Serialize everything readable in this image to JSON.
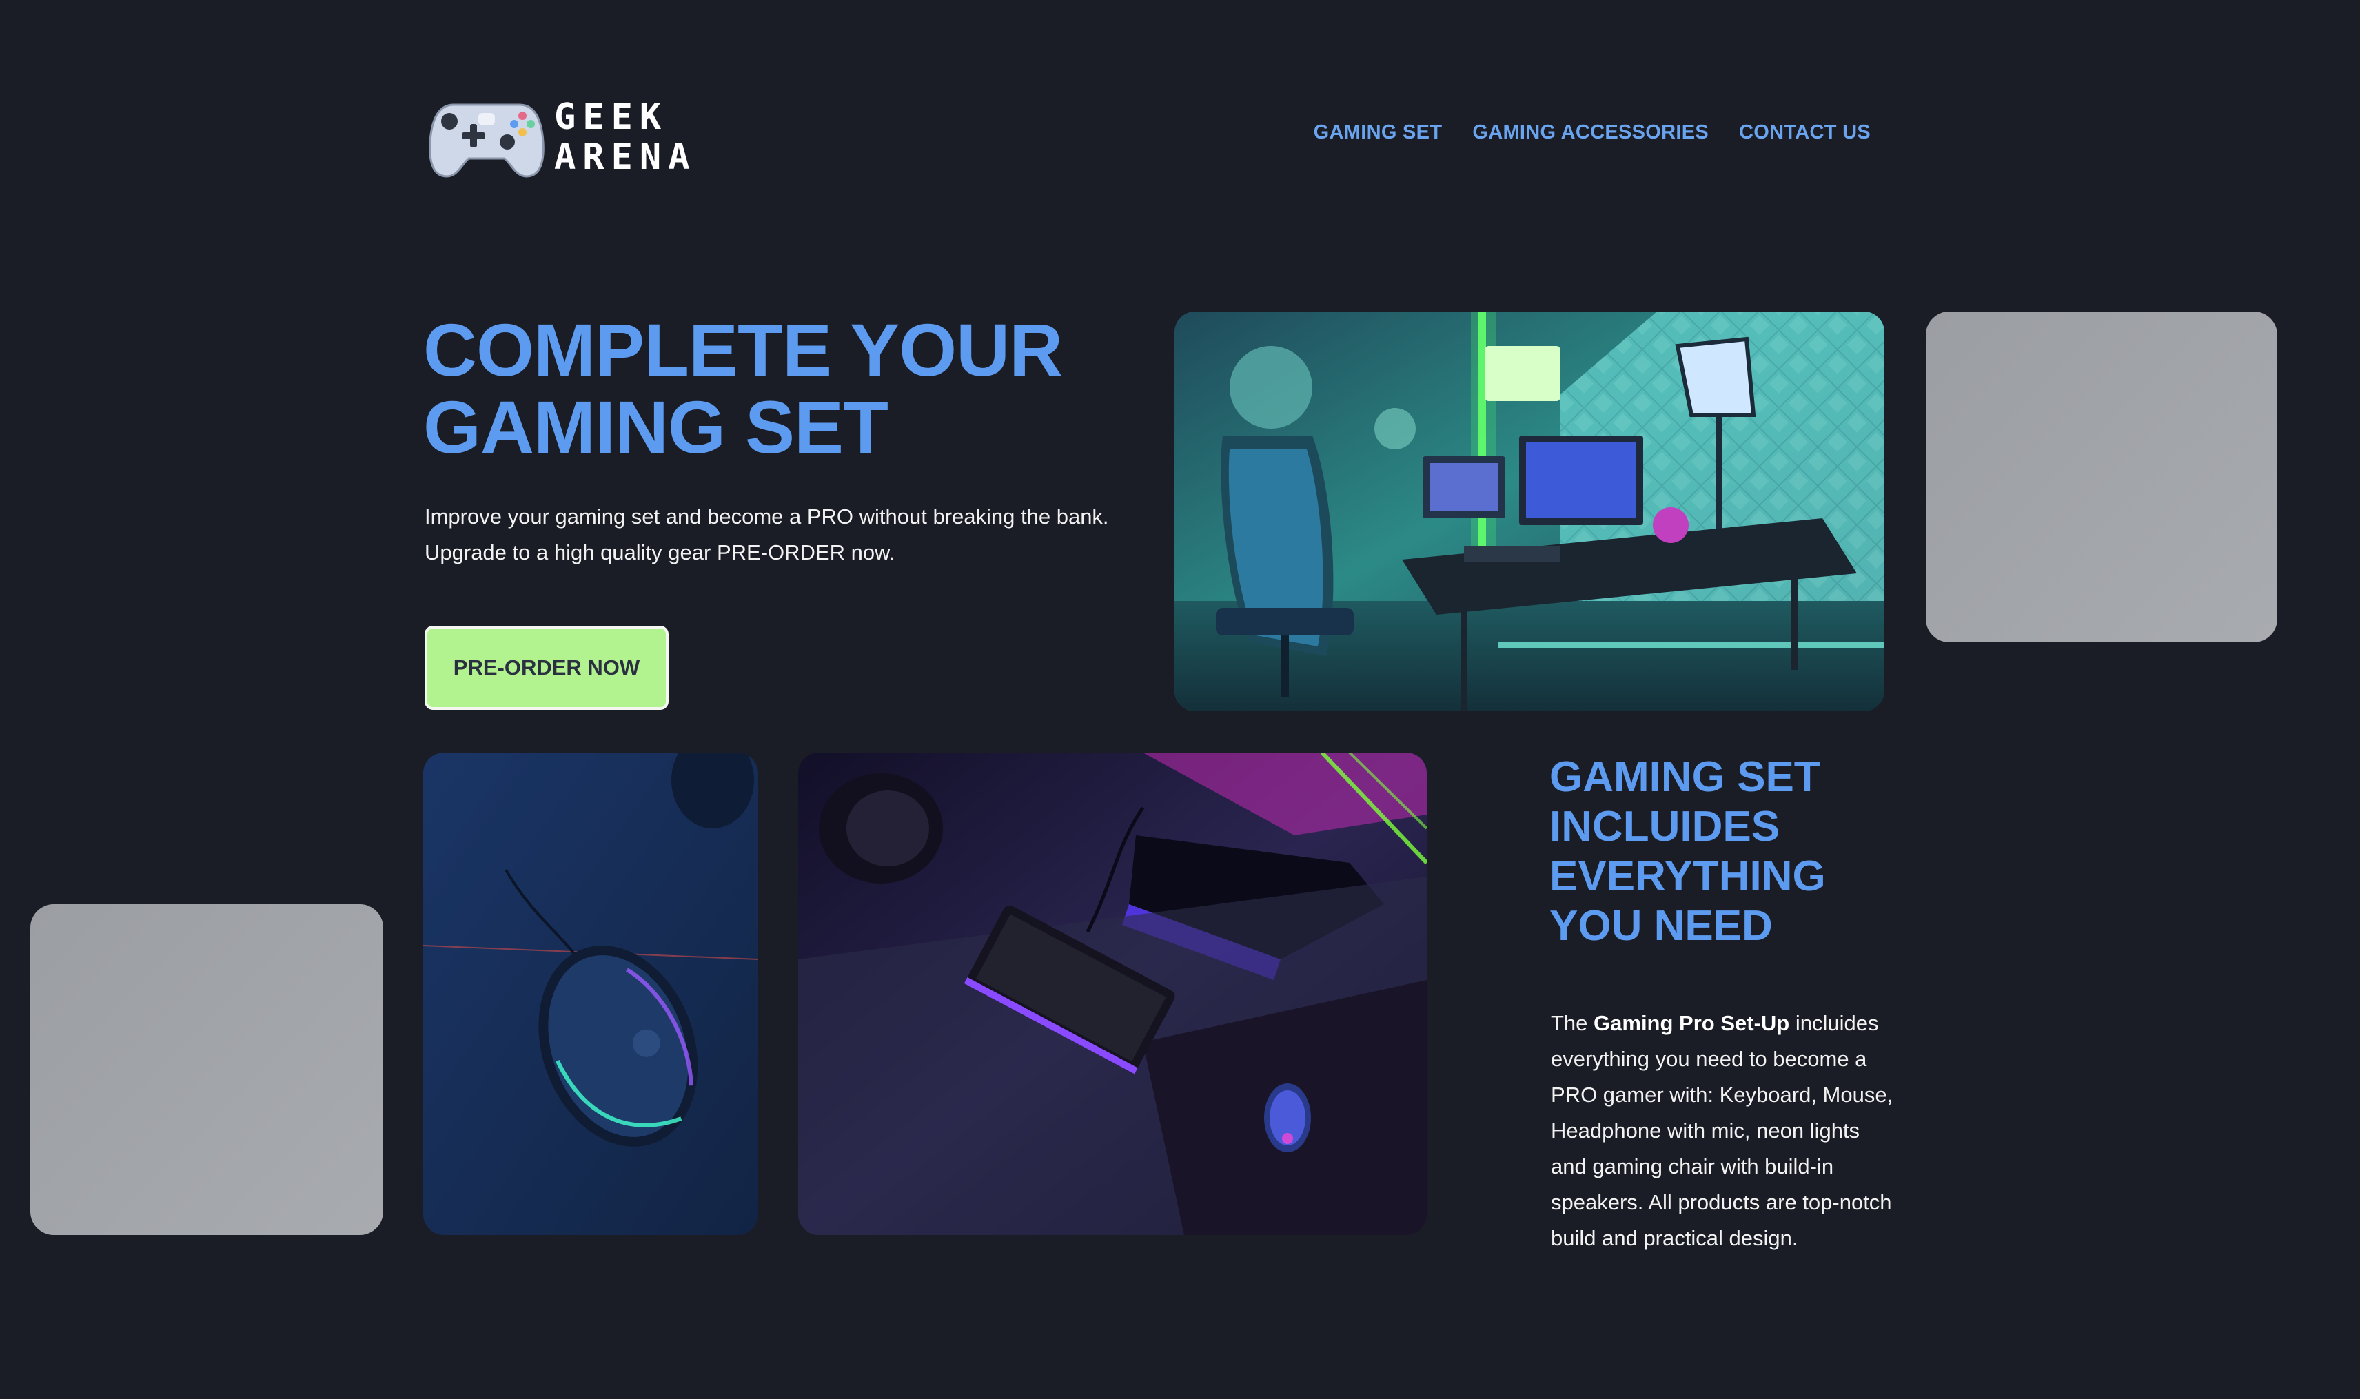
{
  "header": {
    "logo": {
      "line1": "GEEK",
      "line2": "ARENA",
      "icon": "gamepad-icon"
    },
    "nav": [
      {
        "label": "GAMING SET"
      },
      {
        "label": "GAMING ACCESSORIES"
      },
      {
        "label": "CONTACT US"
      }
    ]
  },
  "hero": {
    "title_line1": "COMPLETE YOUR",
    "title_line2": "GAMING SET",
    "subtitle_line1": "Improve your gaming set and become a PRO without breaking the bank.",
    "subtitle_line2": "Upgrade to a high quality gear PRE-ORDER now.",
    "cta_label": "PRE-ORDER NOW"
  },
  "set_section": {
    "title_lines": [
      "GAMING SET",
      "INCLUIDES",
      "EVERYTHING",
      "YOU NEED"
    ],
    "desc_prefix": "The ",
    "desc_bold": "Gaming Pro Set-Up",
    "desc_rest": " incluides everything you need to become a PRO gamer with: Keyboard, Mouse, Headphone with mic, neon lights and gaming chair with build-in speakers. All products are top-notch build and practical design."
  },
  "colors": {
    "background": "#1b1d26",
    "accent_blue": "#5c9bf0",
    "nav_blue": "#6aa4ee",
    "cta_green": "#b2f28f"
  }
}
